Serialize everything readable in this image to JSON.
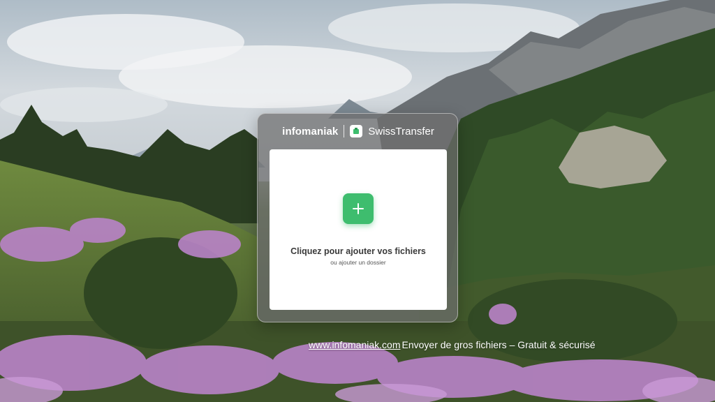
{
  "brand": {
    "company": "infomaniak",
    "product": "SwissTransfer"
  },
  "dropzone": {
    "title": "Cliquez pour ajouter vos fichiers",
    "subtitle_prefix": "ou",
    "subtitle_link": "ajouter un dossier",
    "add_icon": "plus-icon"
  },
  "footer": {
    "link": "www.infomaniak.com",
    "tagline": "Envoyer de gros fichiers – Gratuit & sécurisé"
  },
  "colors": {
    "accent": "#3ebd6e",
    "card_bg": "#6e6e6e",
    "text_dark": "#3a3a3a"
  }
}
